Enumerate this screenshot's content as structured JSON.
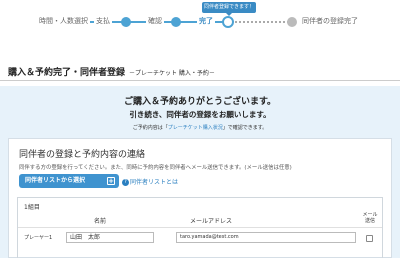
{
  "steps": {
    "items": [
      {
        "label": "時間・人数選択",
        "state": "done"
      },
      {
        "label": "支払",
        "state": "done"
      },
      {
        "label": "確認",
        "state": "done"
      },
      {
        "label": "完了",
        "state": "current"
      },
      {
        "label": "同伴者の登録完了",
        "state": "todo"
      }
    ],
    "current_badge": "同伴者登録できます！"
  },
  "header": {
    "title": "購入＆予約完了・同伴者登録",
    "subtitle": "－プレーチケット 購入・予約－"
  },
  "thanks": {
    "title": "ご購入＆予約ありがとうございます。",
    "message": "引き続き、同伴者の登録をお願いします。",
    "note_prefix": "ご予約内容は「",
    "note_link": "プレーチケット購入状況",
    "note_suffix": "」で確認できます。"
  },
  "companion": {
    "section_title": "同伴者の登録と予約内容の連絡",
    "description": "同伴する方の登録を行ってください。また、同時に予約内容を同伴者へメール送信できます。(メール送信は任意)",
    "select_button": "同伴者リストから選択",
    "help_link": "同伴者リストとは",
    "group_label": "1組目",
    "columns": {
      "name": "名前",
      "email": "メールアドレス",
      "send": "メール送信"
    },
    "rows": [
      {
        "label": "プレーヤー1",
        "name": "山田　太郎",
        "email": "taro.yamada@test.com",
        "send": false
      }
    ]
  },
  "colors": {
    "accent": "#3f93cf",
    "panel_bg": "#e7f2fa",
    "link": "#2a7fc0"
  },
  "icons": {
    "current_step": "step-circle-icon",
    "select_button": "plus-square-icon",
    "help": "question-circle-icon",
    "send": "checkbox-icon"
  }
}
